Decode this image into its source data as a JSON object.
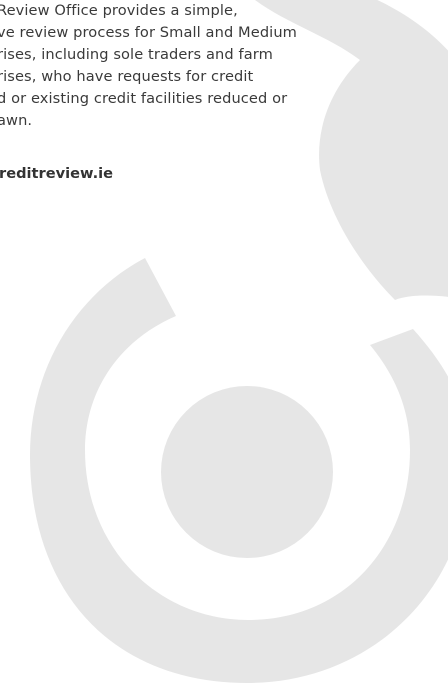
{
  "intro": {
    "lines": [
      "Review Office provides a simple,",
      "ve review process for Small and Medium",
      "rises, including sole traders and farm",
      "rises, who have requests for credit",
      "d or existing credit facilities reduced or",
      "awn."
    ]
  },
  "website": {
    "label": "reditreview.ie"
  },
  "colors": {
    "text": "#3a3a3a",
    "graphic": "#e6e6e6",
    "background": "#ffffff"
  }
}
